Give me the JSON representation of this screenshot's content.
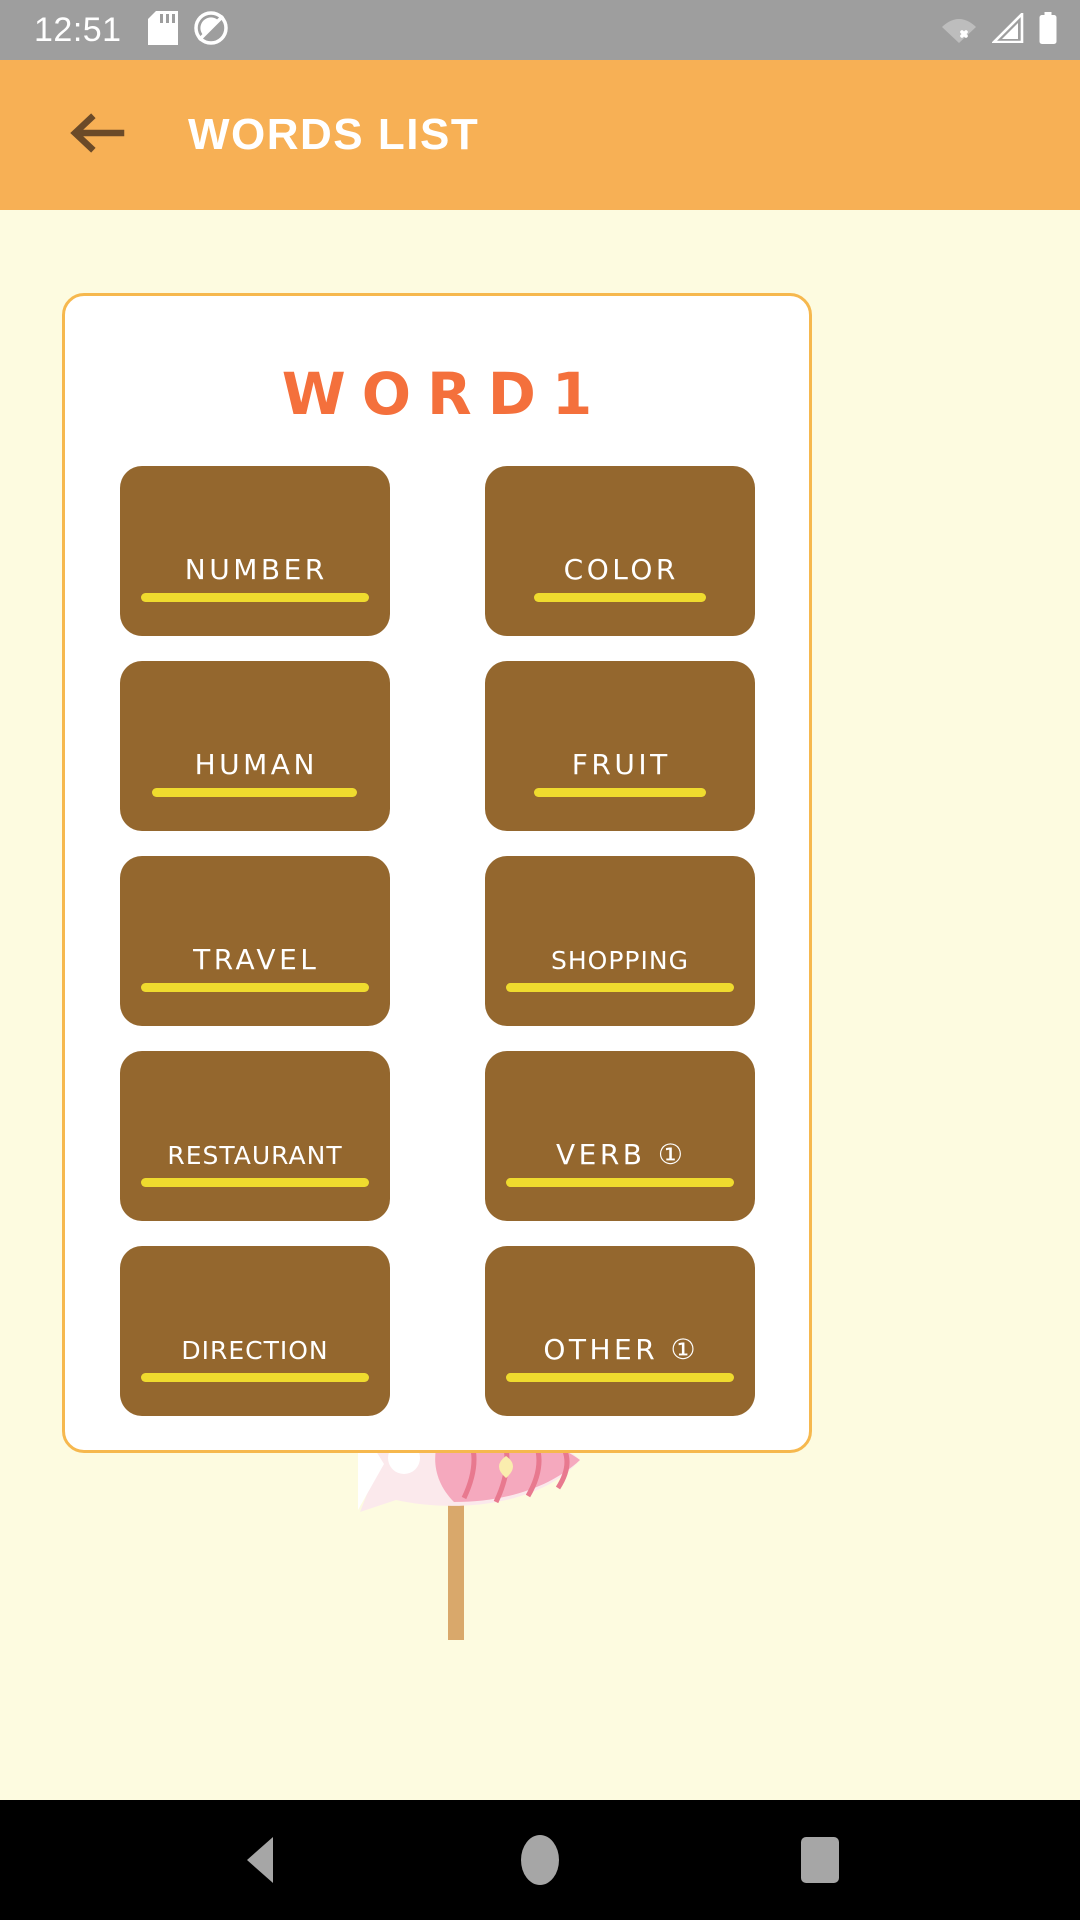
{
  "status_bar": {
    "clock": "12:51",
    "left_icons": [
      "sd-card-icon",
      "data-saver-off-icon"
    ],
    "right_icons": [
      "wifi-off-icon",
      "cellular-signal-icon",
      "battery-full-icon"
    ],
    "background_color": "#9E9E9E"
  },
  "app_bar": {
    "back_icon": "back-arrow-icon",
    "title": "WORDS LIST",
    "background_color": "#F7B055",
    "title_color": "#FFFFFF",
    "icon_color": "#6B4A28"
  },
  "page": {
    "background_color": "#FDFBE0"
  },
  "card": {
    "title": "WORD1",
    "title_color": "#F4703C",
    "border_color": "#F6B84E",
    "background_color": "#FFFFFF",
    "decoration": "koinobori-carp-streamer-illustration"
  },
  "word_buttons": [
    {
      "label": "NUMBER",
      "underline": "wide"
    },
    {
      "label": "COLOR",
      "underline": "narrow"
    },
    {
      "label": "HUMAN",
      "underline": "normal"
    },
    {
      "label": "FRUIT",
      "underline": "narrow"
    },
    {
      "label": "TRAVEL",
      "underline": "wide"
    },
    {
      "label": "SHOPPING",
      "underline": "wide"
    },
    {
      "label": "RESTAURANT",
      "underline": "wide"
    },
    {
      "label": "VERB ①",
      "underline": "wide"
    },
    {
      "label": "DIRECTION",
      "underline": "wide"
    },
    {
      "label": "OTHER ①",
      "underline": "wide"
    }
  ],
  "button_style": {
    "background_color": "#94672E",
    "label_color": "#FFFFFF",
    "underline_color": "#EFDB2E"
  },
  "nav_bar": {
    "buttons": [
      "back-triangle-icon",
      "home-circle-icon",
      "recents-square-icon"
    ],
    "background_color": "#000000",
    "icon_color": "#A6A6A6"
  }
}
